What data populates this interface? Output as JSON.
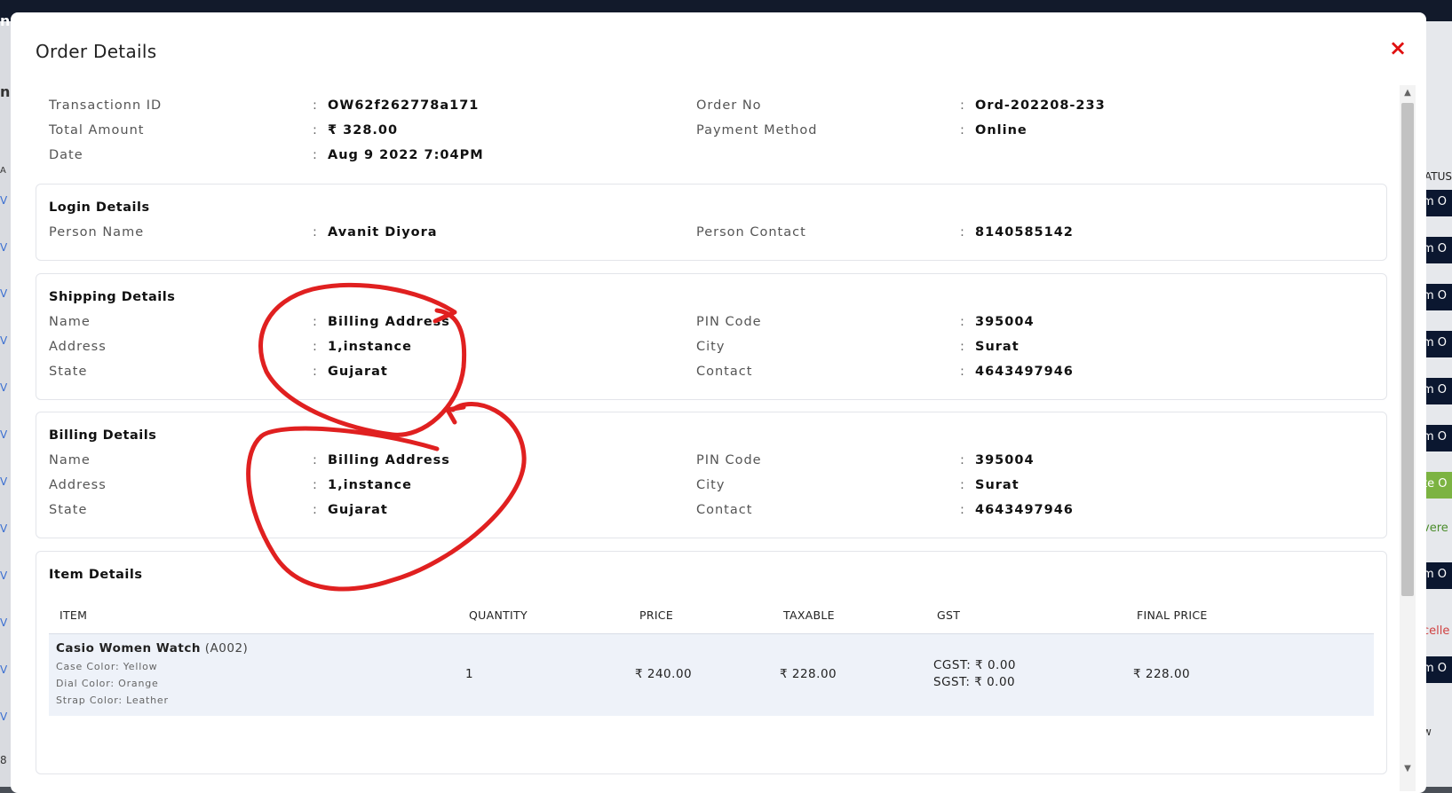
{
  "modal": {
    "title": "Order Details",
    "close_icon": "×"
  },
  "summary": {
    "transaction_label": "Transactionn ID",
    "transaction_value": "OW62f262778a171",
    "total_label": "Total Amount",
    "total_value": "₹ 328.00",
    "date_label": "Date",
    "date_value": "Aug 9 2022 7:04PM",
    "order_no_label": "Order No",
    "order_no_value": "Ord-202208-233",
    "payment_label": "Payment Method",
    "payment_value": "Online"
  },
  "login": {
    "title": "Login Details",
    "person_name_label": "Person Name",
    "person_name_value": "Avanit Diyora",
    "person_contact_label": "Person Contact",
    "person_contact_value": "8140585142"
  },
  "shipping": {
    "title": "Shipping Details",
    "name_label": "Name",
    "name_value": "Billing Address",
    "address_label": "Address",
    "address_value": "1,instance",
    "state_label": "State",
    "state_value": "Gujarat",
    "pin_label": "PIN Code",
    "pin_value": "395004",
    "city_label": "City",
    "city_value": "Surat",
    "contact_label": "Contact",
    "contact_value": "4643497946"
  },
  "billing": {
    "title": "Billing Details",
    "name_label": "Name",
    "name_value": "Billing Address",
    "address_label": "Address",
    "address_value": "1,instance",
    "state_label": "State",
    "state_value": "Gujarat",
    "pin_label": "PIN Code",
    "pin_value": "395004",
    "city_label": "City",
    "city_value": "Surat",
    "contact_label": "Contact",
    "contact_value": "4643497946"
  },
  "items": {
    "title": "Item Details",
    "headers": [
      "ITEM",
      "QUANTITY",
      "PRICE",
      "TAXABLE",
      "GST",
      "FINAL PRICE"
    ],
    "row": {
      "name": "Casio Women Watch",
      "code": "(A002)",
      "case_color": "Case Color: Yellow",
      "dial_color": "Dial Color: Orange",
      "strap_color": "Strap Color: Leather",
      "quantity": "1",
      "price": "₹ 240.00",
      "taxable": "₹ 228.00",
      "cgst": "CGST: ₹ 0.00",
      "sgst": "SGST: ₹ 0.00",
      "final_price": "₹ 228.00"
    }
  },
  "colon": ":",
  "background": {
    "left_letters": [
      "n",
      "n",
      "A",
      "V",
      "V",
      "V",
      "V",
      "V",
      "V",
      "V",
      "V",
      "V",
      "V",
      "V",
      "V",
      "8"
    ],
    "right_texts": [
      "ATUS",
      "m O",
      "m O",
      "m O",
      "m O",
      "m O",
      "m O",
      "te O",
      "vere",
      "m O",
      "celle",
      "m O",
      "w"
    ]
  },
  "colors": {
    "annotation": "#e02020",
    "close": "#e01010"
  }
}
